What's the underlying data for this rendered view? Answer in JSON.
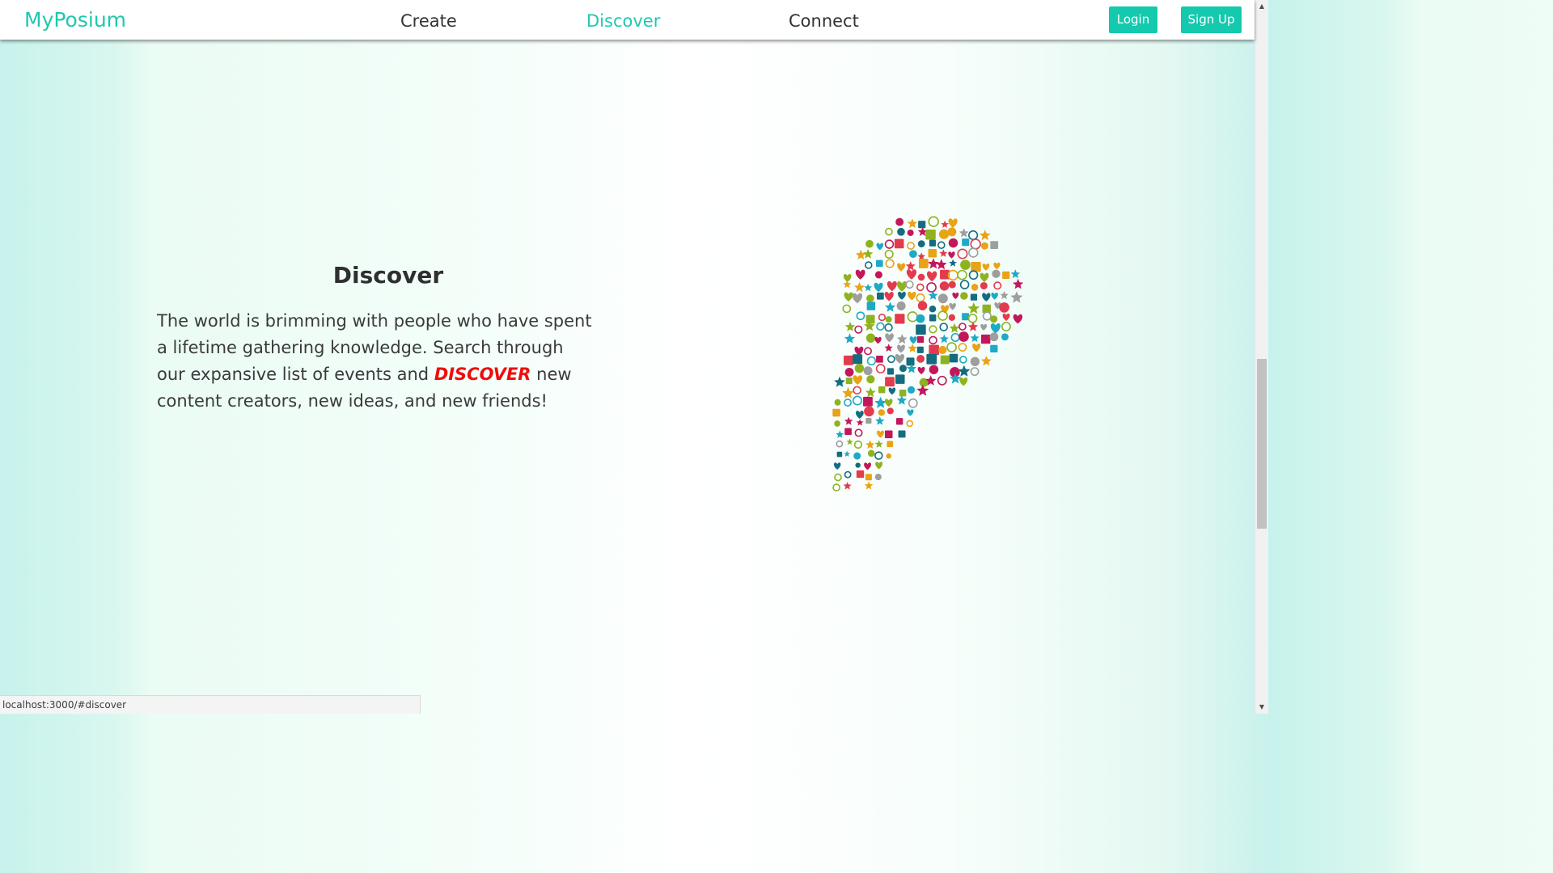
{
  "navbar": {
    "brand": "MyPosium",
    "links": [
      {
        "label": "Create",
        "active": false
      },
      {
        "label": "Discover",
        "active": true
      },
      {
        "label": "Connect",
        "active": false
      }
    ],
    "login_label": "Login",
    "signup_label": "Sign Up"
  },
  "section": {
    "title": "Discover",
    "text_before": "The world is brimming with people who have spent a lifetime gathering knowledge. Search through our expansive list of events and ",
    "emphasis": "DISCOVER",
    "text_after": " new content creators, new ideas, and new friends!",
    "image_icon": "lightbulb-icon-collage"
  },
  "statusbar": {
    "url": "localhost:3000/#discover"
  },
  "colors": {
    "accent": "#1ec8b0",
    "button": "#14c9ad",
    "emphasis": "#f00c0c",
    "icon_palette": [
      "#c2185b",
      "#1ea9c6",
      "#e8a317",
      "#136c80",
      "#e23b4e",
      "#8fb320",
      "#9e9e9e"
    ]
  }
}
